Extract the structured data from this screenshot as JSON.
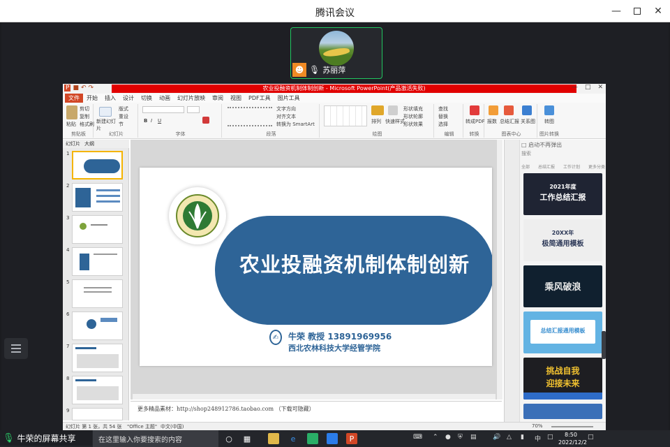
{
  "window": {
    "title": "腾讯会议"
  },
  "participant": {
    "name": "苏丽萍"
  },
  "share_status": {
    "label": "牛荣的屏幕共享"
  },
  "ppt": {
    "window_title": "农业投融资机制体制创新 - Microsoft PowerPoint(产品激活失败)",
    "tabs": [
      "文件",
      "开始",
      "插入",
      "设计",
      "切换",
      "动画",
      "幻灯片放映",
      "审阅",
      "视图",
      "PDF工具",
      "图片工具"
    ],
    "groups": [
      "剪贴板",
      "幻灯片",
      "字体",
      "段落",
      "绘图",
      "编辑",
      "转换",
      "图表中心",
      "图片转换"
    ],
    "ribbon_labels": {
      "paste": "粘贴",
      "cut": "剪切",
      "copy": "复制",
      "format_painter": "格式刷",
      "new_slide": "新建幻灯片",
      "layout": "版式",
      "reset": "重设",
      "section": "节",
      "text_direction": "文字方向",
      "align_text": "对齐文本",
      "smartart": "转换为 SmartArt",
      "arrange": "排列",
      "quick_styles": "快速样式",
      "shape_fill": "形状填充",
      "shape_outline": "形状轮廓",
      "shape_effects": "形状效果",
      "find": "查找",
      "replace": "替换",
      "select": "选择",
      "to_pdf": "转成PDF",
      "report": "报数",
      "summary": "总结汇报",
      "relation": "关系图",
      "to_image": "转图"
    },
    "panel_tabs": [
      "幻灯片",
      "大纲"
    ],
    "thumb_numbers": [
      "1",
      "2",
      "3",
      "4",
      "5",
      "6",
      "7",
      "8",
      "9"
    ],
    "slide": {
      "title": "农业投融资机制体制创新",
      "author_line": "牛荣  教授   13891969956",
      "school_line": "西北农林科技大学经管学院"
    },
    "notes": "更多精品素材：http://shop248912786.taobao.com （下载可隐藏）",
    "status": {
      "slide_info": "幻灯片 第 1 张，共 54 张",
      "theme": "\"Office 主题\"",
      "lang": "中文(中国)",
      "zoom": "70%"
    },
    "template_pane": {
      "header": "启动不再弹出",
      "search_placeholder": "搜索",
      "filters": [
        "全部",
        "总结汇报",
        "工作计划"
      ],
      "filter_more": "更多分类",
      "cards": [
        {
          "line1": "2021年度",
          "line2": "工作总结汇报",
          "bg": "#1f2433",
          "fg": "#ffffff"
        },
        {
          "line1": "20XX年",
          "line2": "极简通用模板",
          "bg": "#eeeeee",
          "fg": "#2e3a59"
        },
        {
          "line1": "乘风破浪",
          "line2": "",
          "bg": "#10202f",
          "fg": "#e8e8e8"
        },
        {
          "line1": "总结汇报通用模板",
          "line2": "",
          "bg": "#63b3e3",
          "fg": "#ffffff"
        },
        {
          "line1": "挑战自我",
          "line2": "迎接未来",
          "bg": "#1e1e22",
          "fg": "#f2c230"
        }
      ]
    }
  },
  "taskbar": {
    "search_placeholder": "在这里输入你要搜索的内容",
    "ime": "中",
    "time": "8:50",
    "date": "2022/12/2"
  }
}
